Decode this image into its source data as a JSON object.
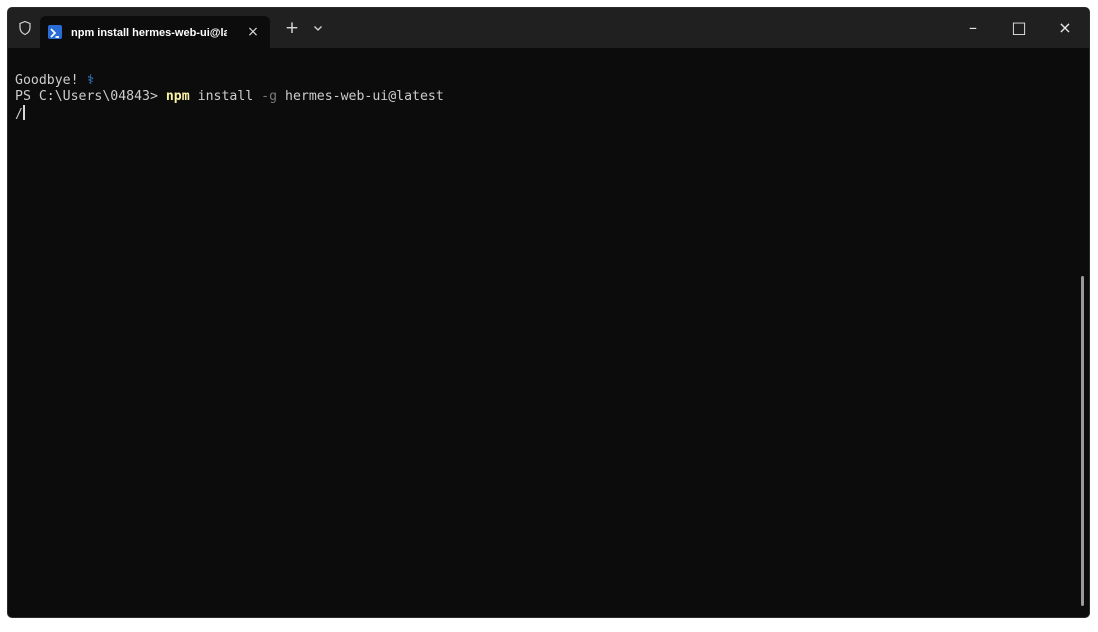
{
  "window": {
    "tab_title": "npm install hermes-web-ui@la",
    "tab_icon": "powershell-icon",
    "controls": {
      "close_tab": "×",
      "new_tab": "+",
      "minimize": "–",
      "maximize": "□",
      "close_window": "×"
    }
  },
  "terminal": {
    "line_1": {
      "text": "Goodbye! ",
      "symbol": "⚕"
    },
    "line_2": {
      "prompt": "PS C:\\Users\\04843> ",
      "command": "npm",
      "space_1": " install ",
      "flag": "-g",
      "space_2": " ",
      "package": "hermes-web-ui@latest"
    },
    "line_3": {
      "spinner": "/"
    }
  },
  "colors": {
    "background": "#0c0c0c",
    "titlebar": "#202020",
    "foreground": "#cccccc",
    "command": "#f9f1a5",
    "accent": "#3b8eea"
  }
}
